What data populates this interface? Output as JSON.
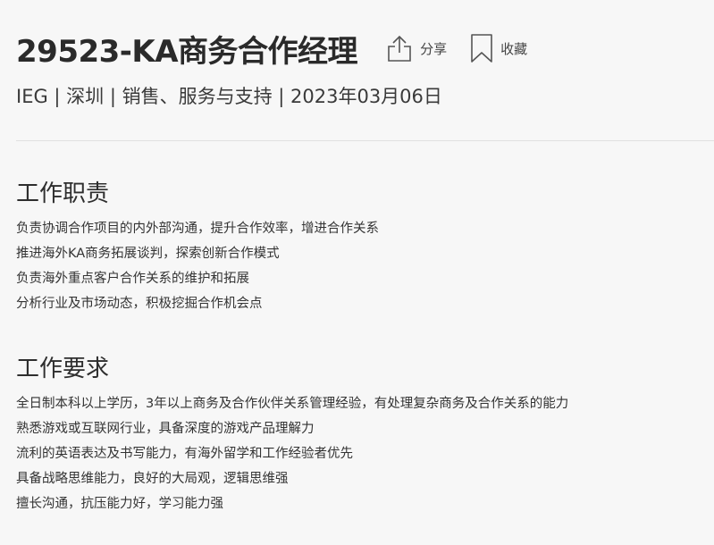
{
  "job": {
    "title": "29523-KA商务合作经理",
    "meta": "IEG | 深圳 | 销售、服务与支持 | 2023年03月06日"
  },
  "actions": {
    "share_label": "分享",
    "share_icon": "share-icon",
    "favorite_label": "收藏",
    "favorite_icon": "bookmark-icon"
  },
  "responsibilities": {
    "heading": "工作职责",
    "items": [
      "负责协调合作项目的内外部沟通，提升合作效率，增进合作关系",
      "推进海外KA商务拓展谈判，探索创新合作模式",
      "负责海外重点客户合作关系的维护和拓展",
      "分析行业及市场动态，积极挖掘合作机会点"
    ]
  },
  "requirements": {
    "heading": "工作要求",
    "items": [
      "全日制本科以上学历，3年以上商务及合作伙伴关系管理经验，有处理复杂商务及合作关系的能力",
      "熟悉游戏或互联网行业，具备深度的游戏产品理解力",
      "流利的英语表达及书写能力，有海外留学和工作经验者优先",
      "具备战略思维能力，良好的大局观，逻辑思维强",
      "擅长沟通，抗压能力好，学习能力强"
    ]
  },
  "colors": {
    "background": "#f7f7f7",
    "text": "#333333",
    "divider": "#e0e0e0"
  }
}
